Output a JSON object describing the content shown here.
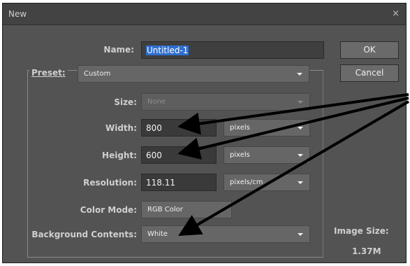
{
  "dialog": {
    "title": "New",
    "close_glyph": "×"
  },
  "form": {
    "name_label": "Name:",
    "name_value": "Untitled-1",
    "preset_label": "Preset:",
    "preset_value": "Custom",
    "size_label": "Size:",
    "size_value": "None",
    "width_label": "Width:",
    "width_value": "800",
    "width_unit": "pixels",
    "height_label": "Height:",
    "height_value": "600",
    "height_unit": "pixels",
    "resolution_label": "Resolution:",
    "resolution_value": "118.11",
    "resolution_unit": "pixels/cm",
    "color_mode_label": "Color Mode:",
    "color_mode_value": "RGB Color",
    "background_label": "Background Contents:",
    "background_value": "White"
  },
  "buttons": {
    "ok_label": "OK",
    "cancel_label": "Cancel"
  },
  "info": {
    "image_size_label": "Image Size:",
    "image_size_value": "1.37M"
  },
  "colors": {
    "dialog_bg": "#535353",
    "name_highlight": "#2f6fcf",
    "annotation_arrows": "#000000"
  }
}
